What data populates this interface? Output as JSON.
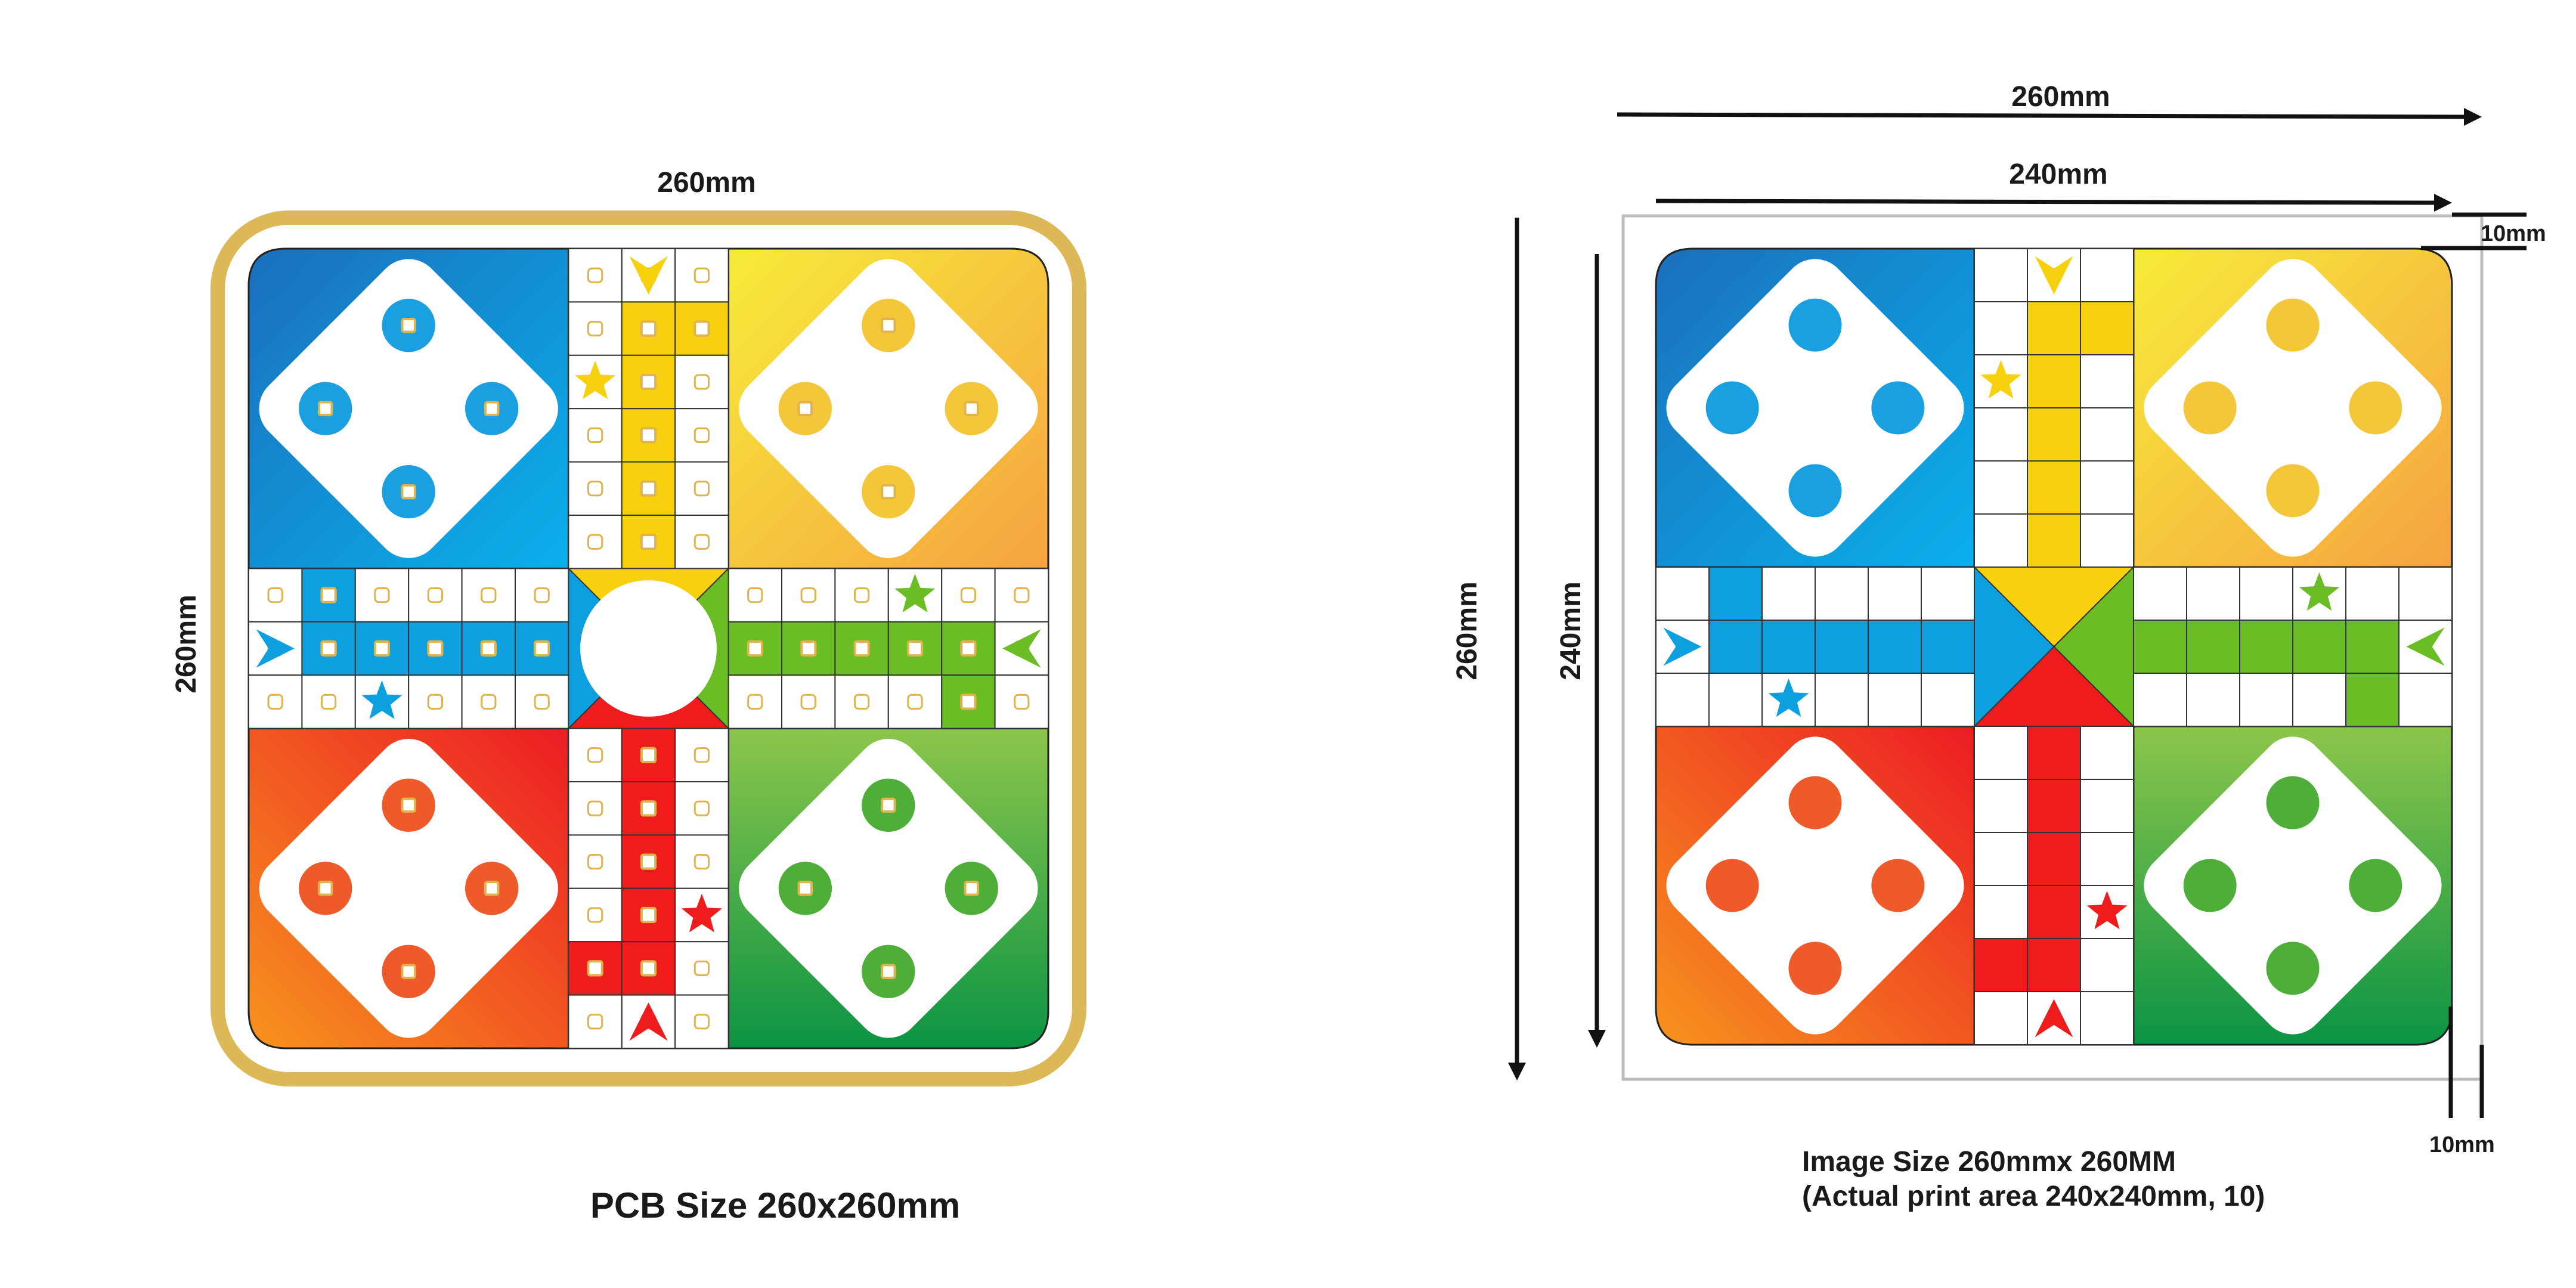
{
  "left_panel": {
    "dim_top": "260mm",
    "dim_side": "260mm",
    "caption": "PCB Size 260x260mm"
  },
  "right_panel": {
    "dim_outer_top": "260mm",
    "dim_inner_top": "240mm",
    "dim_outer_side": "260mm",
    "dim_inner_side": "240mm",
    "margin_top_right": "10mm",
    "margin_bottom_right": "10mm",
    "caption_line1": "Image Size 260mmx 260MM",
    "caption_line2": "(Actual print area 240x240mm, 10)"
  },
  "colors": {
    "blue": "#0e9fdf",
    "yellow": "#f7d10e",
    "red": "#ee1c1c",
    "green": "#6abd25",
    "pcb_border": "#dcb857",
    "pad": "#e0b34c"
  }
}
